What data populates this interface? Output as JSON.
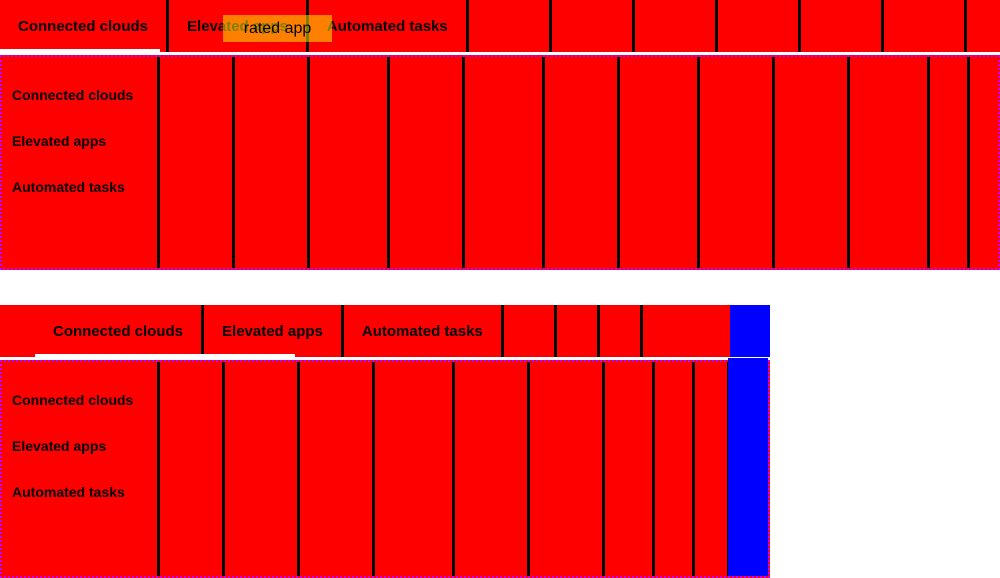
{
  "tabs": {
    "tab1": "Connected clouds",
    "tab2": "Elevated apps",
    "tab3": "Automated tasks"
  },
  "labels": {
    "connected_clouds": "Connected clouds",
    "elevated_apps": "Elevated apps",
    "automated_tasks": "Automated tasks"
  },
  "highlight": {
    "text": "rated app"
  },
  "colors": {
    "red": "#ff0000",
    "blue": "#0000ff",
    "black": "#000000",
    "dotted_border": "#c400ff",
    "white": "#ffffff"
  },
  "dividers": {
    "full_panel": [
      160,
      230,
      310,
      385,
      465,
      545,
      620,
      700,
      775,
      850,
      925
    ],
    "win_panel": [
      160,
      220,
      295,
      375,
      455,
      530,
      605,
      685,
      730
    ]
  },
  "top_tab_dividers": [
    160,
    230,
    310,
    385,
    465,
    545,
    620,
    700,
    775,
    850,
    925
  ],
  "win_tab_dividers": [
    160,
    220,
    295,
    375,
    455,
    530,
    605,
    685,
    730
  ]
}
